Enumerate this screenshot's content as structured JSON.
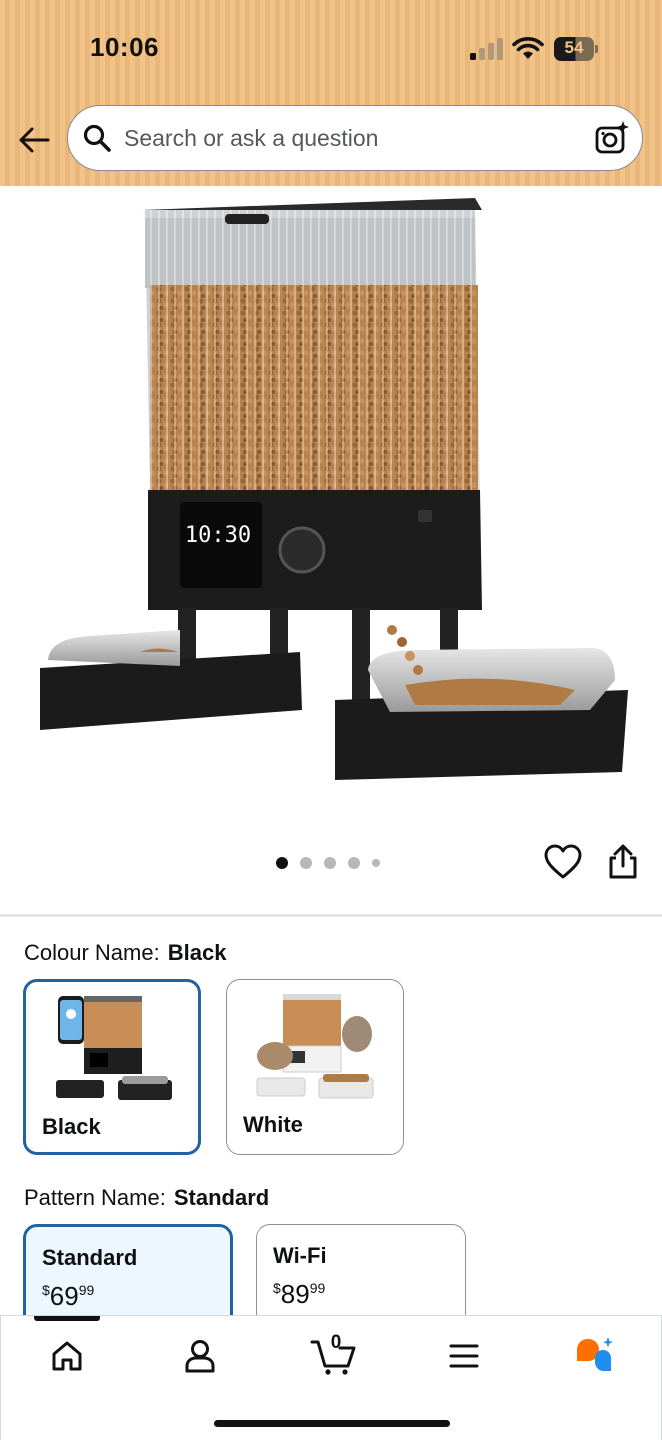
{
  "status_bar": {
    "time": "10:06",
    "battery": "54",
    "icons": [
      "cellular-signal-icon",
      "wifi-icon",
      "battery-icon"
    ]
  },
  "search": {
    "placeholder": "Search or ask a question",
    "value": "",
    "icons": [
      "back-arrow-icon",
      "search-icon",
      "camera-lens-icon"
    ]
  },
  "gallery": {
    "image": "automatic pet feeder, black",
    "page_count": 5,
    "active_page": 1,
    "icons": [
      "heart-icon",
      "share-icon"
    ]
  },
  "colour": {
    "label": "Colour Name:",
    "selected": "Black",
    "options": [
      {
        "name": "Black",
        "selected": true
      },
      {
        "name": "White",
        "selected": false
      }
    ]
  },
  "pattern": {
    "label": "Pattern Name:",
    "selected": "Standard",
    "options": [
      {
        "name": "Standard",
        "currency": "$",
        "whole": "69",
        "fraction": "99",
        "selected": true
      },
      {
        "name": "Wi-Fi",
        "currency": "$",
        "whole": "89",
        "fraction": "99",
        "selected": false
      }
    ]
  },
  "bottom_nav": {
    "cart_count": "0",
    "items": [
      "home-icon",
      "account-icon",
      "cart-icon",
      "menu-icon",
      "rufus-icon"
    ],
    "active": "home-icon"
  },
  "colors": {
    "header_bg": "#f1c389",
    "selected_border": "#2162a1",
    "selected_bg": "#edf7ff",
    "rufus_orange": "#ff6f00",
    "rufus_blue": "#1f8ef1"
  }
}
